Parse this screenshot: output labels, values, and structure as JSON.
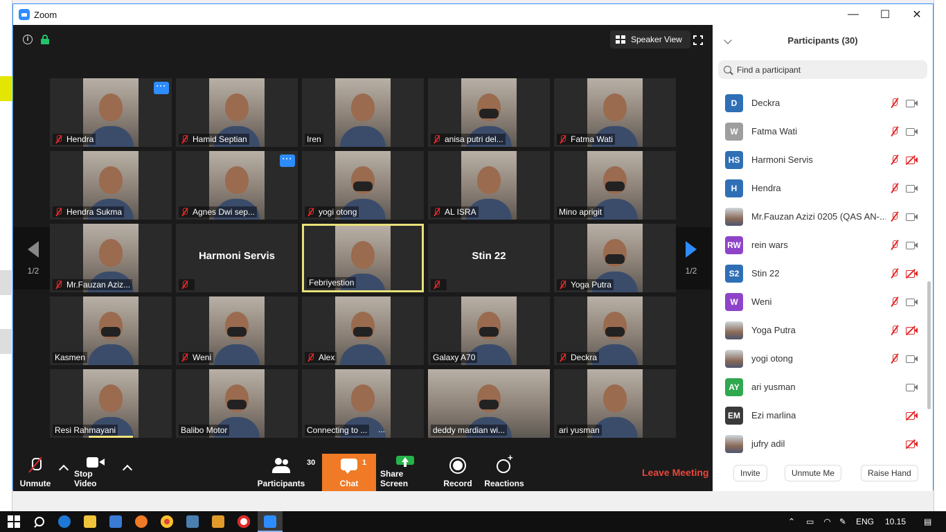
{
  "window": {
    "title": "Zoom",
    "controls": {
      "minimize": "—",
      "maximize": "☐",
      "close": "✕"
    }
  },
  "meeting": {
    "view_button": "Speaker View",
    "page_left": "1/2",
    "page_right": "1/2",
    "tiles": [
      {
        "name": "Hendra",
        "muted": true,
        "video": true,
        "more": true
      },
      {
        "name": "Hamid Septian",
        "muted": true,
        "video": true
      },
      {
        "name": "Iren",
        "muted": false,
        "video": true
      },
      {
        "name": "anisa putri del...",
        "muted": true,
        "video": true
      },
      {
        "name": "Fatma Wati",
        "muted": true,
        "video": true
      },
      {
        "name": "Hendra Sukma",
        "muted": true,
        "video": true
      },
      {
        "name": "Agnes Dwi sep...",
        "muted": true,
        "video": true,
        "more": true
      },
      {
        "name": "yogi otong",
        "muted": true,
        "video": true
      },
      {
        "name": "AL ISRA",
        "muted": true,
        "video": true
      },
      {
        "name": "Mino aprigit",
        "muted": false,
        "video": true
      },
      {
        "name": "Mr.Fauzan Aziz...",
        "muted": true,
        "video": true
      },
      {
        "name": "Harmoni Servis",
        "muted": true,
        "video": false
      },
      {
        "name": "Febriyestion",
        "muted": false,
        "video": true,
        "active": true
      },
      {
        "name": "Stin 22",
        "muted": true,
        "video": false
      },
      {
        "name": "Yoga Putra",
        "muted": true,
        "video": true
      },
      {
        "name": "Kasmen",
        "muted": false,
        "video": true
      },
      {
        "name": "Weni",
        "muted": true,
        "video": true
      },
      {
        "name": "Alex",
        "muted": true,
        "video": true
      },
      {
        "name": "Galaxy A70",
        "muted": false,
        "video": true
      },
      {
        "name": "Deckra",
        "muted": true,
        "video": true
      },
      {
        "name": "Resi Rahmayani",
        "muted": false,
        "video": true,
        "talking": true
      },
      {
        "name": "Balibo Motor",
        "muted": false,
        "video": true
      },
      {
        "name": "Connecting to ...",
        "muted": false,
        "video": true,
        "ellipsis": "..."
      },
      {
        "name": "deddy mardian wi...",
        "muted": false,
        "video": true
      },
      {
        "name": "ari yusman",
        "muted": false,
        "video": true
      }
    ]
  },
  "toolbar": {
    "unmute": "Unmute",
    "stop_video": "Stop Video",
    "participants": "Participants",
    "participants_count": "30",
    "chat": "Chat",
    "chat_count": "1",
    "share_screen": "Share Screen",
    "record": "Record",
    "reactions": "Reactions",
    "leave": "Leave Meeting"
  },
  "panel": {
    "title": "Participants (30)",
    "search_placeholder": "Find a participant",
    "participants": [
      {
        "initials": "D",
        "name": "Deckra",
        "color": "#2f6fb5",
        "mic_muted": true,
        "cam_off": false
      },
      {
        "initials": "W",
        "name": "Fatma Wati",
        "color": "#9e9e9e",
        "mic_muted": true,
        "cam_off": false
      },
      {
        "initials": "HS",
        "name": "Harmoni Servis",
        "color": "#2f6fb5",
        "mic_muted": true,
        "cam_off": true
      },
      {
        "initials": "H",
        "name": "Hendra",
        "color": "#2f6fb5",
        "mic_muted": true,
        "cam_off": false
      },
      {
        "initials": "",
        "name": "Mr.Fauzan Azizi 0205 (QAS AN-...",
        "color": "",
        "mic_muted": true,
        "cam_off": false,
        "photo": true
      },
      {
        "initials": "RW",
        "name": "rein wars",
        "color": "#8e44c9",
        "mic_muted": true,
        "cam_off": false
      },
      {
        "initials": "S2",
        "name": "Stin 22",
        "color": "#2f6fb5",
        "mic_muted": true,
        "cam_off": true
      },
      {
        "initials": "W",
        "name": "Weni",
        "color": "#8e44c9",
        "mic_muted": true,
        "cam_off": false
      },
      {
        "initials": "",
        "name": "Yoga Putra",
        "color": "",
        "mic_muted": true,
        "cam_off": true,
        "photo": true
      },
      {
        "initials": "",
        "name": "yogi otong",
        "color": "",
        "mic_muted": true,
        "cam_off": false,
        "photo": true
      },
      {
        "initials": "AY",
        "name": "ari yusman",
        "color": "#2fa84f",
        "mic_muted": false,
        "cam_off": false
      },
      {
        "initials": "EM",
        "name": "Ezi marlina",
        "color": "#3a3a3a",
        "mic_muted": false,
        "cam_off": true
      },
      {
        "initials": "",
        "name": "jufry adil",
        "color": "",
        "mic_muted": false,
        "cam_off": true,
        "photo": true
      }
    ],
    "buttons": {
      "invite": "Invite",
      "unmute_me": "Unmute Me",
      "raise_hand": "Raise Hand"
    }
  },
  "taskbar": {
    "language": "ENG",
    "time": "10.15"
  },
  "colors": {
    "accent": "#2d8cff",
    "chat_orange": "#f07a25",
    "leave_red": "#e8473c",
    "mute_red": "#e02828",
    "share_green": "#25b34a"
  }
}
